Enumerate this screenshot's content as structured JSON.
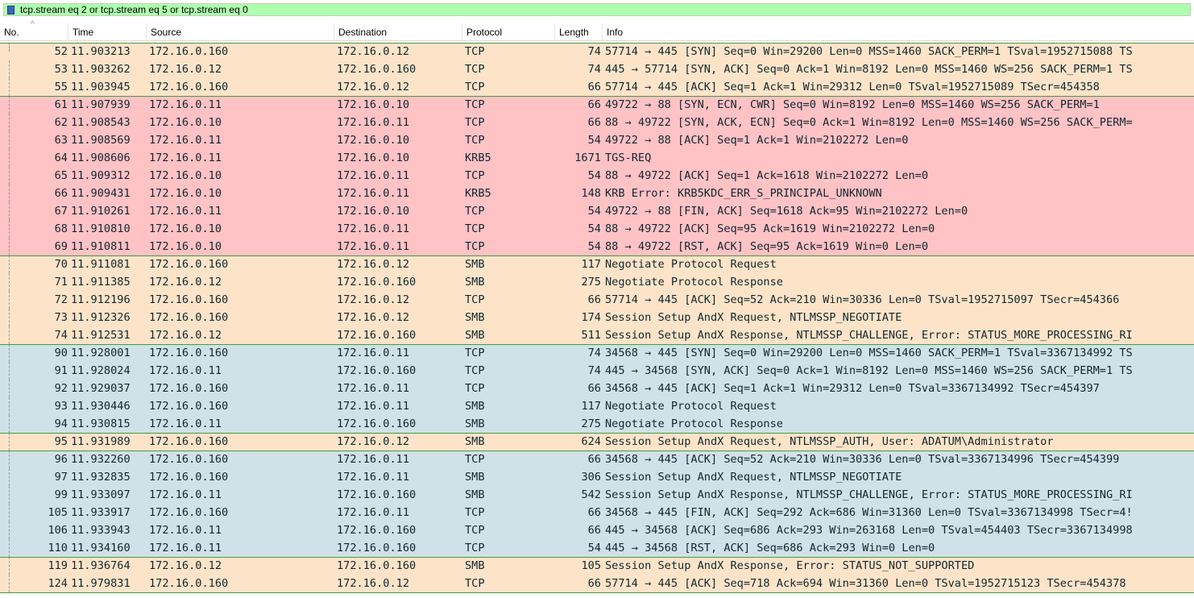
{
  "filter": {
    "text": "tcp.stream eq 2 or tcp.stream eq 5 or tcp.stream eq 0"
  },
  "columns": {
    "no": "No.",
    "time": "Time",
    "source": "Source",
    "destination": "Destination",
    "protocol": "Protocol",
    "length": "Length",
    "info": "Info"
  },
  "colors": {
    "smb": "#fde4c9",
    "kerberos": "#ffc2c5",
    "tcp_blue": "#cfe2e7",
    "separator_green": "#4a9a3c",
    "filter_bg": "#afffaf"
  },
  "packets": [
    {
      "no": "52",
      "time": "11.903213",
      "src": "172.16.0.160",
      "dst": "172.16.0.12",
      "proto": "TCP",
      "len": "74",
      "info": "57714 → 445 [SYN] Seq=0 Win=29200 Len=0 MSS=1460 SACK_PERM=1 TSval=1952715088 TS",
      "color": "smb"
    },
    {
      "no": "53",
      "time": "11.903262",
      "src": "172.16.0.12",
      "dst": "172.16.0.160",
      "proto": "TCP",
      "len": "74",
      "info": "445 → 57714 [SYN, ACK] Seq=0 Ack=1 Win=8192 Len=0 MSS=1460 WS=256 SACK_PERM=1 TS",
      "color": "smb"
    },
    {
      "no": "55",
      "time": "11.903945",
      "src": "172.16.0.160",
      "dst": "172.16.0.12",
      "proto": "TCP",
      "len": "66",
      "info": "57714 → 445 [ACK] Seq=1 Ack=1 Win=29312 Len=0 TSval=1952715089 TSecr=454358",
      "color": "smb"
    },
    {
      "no": "61",
      "time": "11.907939",
      "src": "172.16.0.11",
      "dst": "172.16.0.10",
      "proto": "TCP",
      "len": "66",
      "info": "49722 → 88 [SYN, ECN, CWR] Seq=0 Win=8192 Len=0 MSS=1460 WS=256 SACK_PERM=1",
      "color": "kerberos"
    },
    {
      "no": "62",
      "time": "11.908543",
      "src": "172.16.0.10",
      "dst": "172.16.0.11",
      "proto": "TCP",
      "len": "66",
      "info": "88 → 49722 [SYN, ACK, ECN] Seq=0 Ack=1 Win=8192 Len=0 MSS=1460 WS=256 SACK_PERM=",
      "color": "kerberos"
    },
    {
      "no": "63",
      "time": "11.908569",
      "src": "172.16.0.11",
      "dst": "172.16.0.10",
      "proto": "TCP",
      "len": "54",
      "info": "49722 → 88 [ACK] Seq=1 Ack=1 Win=2102272 Len=0",
      "color": "kerberos"
    },
    {
      "no": "64",
      "time": "11.908606",
      "src": "172.16.0.11",
      "dst": "172.16.0.10",
      "proto": "KRB5",
      "len": "1671",
      "info": "TGS-REQ",
      "color": "kerberos"
    },
    {
      "no": "65",
      "time": "11.909312",
      "src": "172.16.0.10",
      "dst": "172.16.0.11",
      "proto": "TCP",
      "len": "54",
      "info": "88 → 49722 [ACK] Seq=1 Ack=1618 Win=2102272 Len=0",
      "color": "kerberos"
    },
    {
      "no": "66",
      "time": "11.909431",
      "src": "172.16.0.10",
      "dst": "172.16.0.11",
      "proto": "KRB5",
      "len": "148",
      "info": "KRB Error: KRB5KDC_ERR_S_PRINCIPAL_UNKNOWN",
      "color": "kerberos"
    },
    {
      "no": "67",
      "time": "11.910261",
      "src": "172.16.0.11",
      "dst": "172.16.0.10",
      "proto": "TCP",
      "len": "54",
      "info": "49722 → 88 [FIN, ACK] Seq=1618 Ack=95 Win=2102272 Len=0",
      "color": "kerberos"
    },
    {
      "no": "68",
      "time": "11.910810",
      "src": "172.16.0.10",
      "dst": "172.16.0.11",
      "proto": "TCP",
      "len": "54",
      "info": "88 → 49722 [ACK] Seq=95 Ack=1619 Win=2102272 Len=0",
      "color": "kerberos"
    },
    {
      "no": "69",
      "time": "11.910811",
      "src": "172.16.0.10",
      "dst": "172.16.0.11",
      "proto": "TCP",
      "len": "54",
      "info": "88 → 49722 [RST, ACK] Seq=95 Ack=1619 Win=0 Len=0",
      "color": "kerberos"
    },
    {
      "no": "70",
      "time": "11.911081",
      "src": "172.16.0.160",
      "dst": "172.16.0.12",
      "proto": "SMB",
      "len": "117",
      "info": "Negotiate Protocol Request",
      "color": "smb"
    },
    {
      "no": "71",
      "time": "11.911385",
      "src": "172.16.0.12",
      "dst": "172.16.0.160",
      "proto": "SMB",
      "len": "275",
      "info": "Negotiate Protocol Response",
      "color": "smb"
    },
    {
      "no": "72",
      "time": "11.912196",
      "src": "172.16.0.160",
      "dst": "172.16.0.12",
      "proto": "TCP",
      "len": "66",
      "info": "57714 → 445 [ACK] Seq=52 Ack=210 Win=30336 Len=0 TSval=1952715097 TSecr=454366",
      "color": "smb"
    },
    {
      "no": "73",
      "time": "11.912326",
      "src": "172.16.0.160",
      "dst": "172.16.0.12",
      "proto": "SMB",
      "len": "174",
      "info": "Session Setup AndX Request, NTLMSSP_NEGOTIATE",
      "color": "smb"
    },
    {
      "no": "74",
      "time": "11.912531",
      "src": "172.16.0.12",
      "dst": "172.16.0.160",
      "proto": "SMB",
      "len": "511",
      "info": "Session Setup AndX Response, NTLMSSP_CHALLENGE, Error: STATUS_MORE_PROCESSING_RI",
      "color": "smb"
    },
    {
      "no": "90",
      "time": "11.928001",
      "src": "172.16.0.160",
      "dst": "172.16.0.11",
      "proto": "TCP",
      "len": "74",
      "info": "34568 → 445 [SYN] Seq=0 Win=29200 Len=0 MSS=1460 SACK_PERM=1 TSval=3367134992 TS",
      "color": "tcp_blue"
    },
    {
      "no": "91",
      "time": "11.928024",
      "src": "172.16.0.11",
      "dst": "172.16.0.160",
      "proto": "TCP",
      "len": "74",
      "info": "445 → 34568 [SYN, ACK] Seq=0 Ack=1 Win=8192 Len=0 MSS=1460 WS=256 SACK_PERM=1 TS",
      "color": "tcp_blue"
    },
    {
      "no": "92",
      "time": "11.929037",
      "src": "172.16.0.160",
      "dst": "172.16.0.11",
      "proto": "TCP",
      "len": "66",
      "info": "34568 → 445 [ACK] Seq=1 Ack=1 Win=29312 Len=0 TSval=3367134992 TSecr=454397",
      "color": "tcp_blue"
    },
    {
      "no": "93",
      "time": "11.930446",
      "src": "172.16.0.160",
      "dst": "172.16.0.11",
      "proto": "SMB",
      "len": "117",
      "info": "Negotiate Protocol Request",
      "color": "tcp_blue"
    },
    {
      "no": "94",
      "time": "11.930815",
      "src": "172.16.0.11",
      "dst": "172.16.0.160",
      "proto": "SMB",
      "len": "275",
      "info": "Negotiate Protocol Response",
      "color": "tcp_blue"
    },
    {
      "no": "95",
      "time": "11.931989",
      "src": "172.16.0.160",
      "dst": "172.16.0.12",
      "proto": "SMB",
      "len": "624",
      "info": "Session Setup AndX Request, NTLMSSP_AUTH, User: ADATUM\\Administrator",
      "color": "smb"
    },
    {
      "no": "96",
      "time": "11.932260",
      "src": "172.16.0.160",
      "dst": "172.16.0.11",
      "proto": "TCP",
      "len": "66",
      "info": "34568 → 445 [ACK] Seq=52 Ack=210 Win=30336 Len=0 TSval=3367134996 TSecr=454399",
      "color": "tcp_blue"
    },
    {
      "no": "97",
      "time": "11.932835",
      "src": "172.16.0.160",
      "dst": "172.16.0.11",
      "proto": "SMB",
      "len": "306",
      "info": "Session Setup AndX Request, NTLMSSP_NEGOTIATE",
      "color": "tcp_blue"
    },
    {
      "no": "99",
      "time": "11.933097",
      "src": "172.16.0.11",
      "dst": "172.16.0.160",
      "proto": "SMB",
      "len": "542",
      "info": "Session Setup AndX Response, NTLMSSP_CHALLENGE, Error: STATUS_MORE_PROCESSING_RI",
      "color": "tcp_blue"
    },
    {
      "no": "105",
      "time": "11.933917",
      "src": "172.16.0.160",
      "dst": "172.16.0.11",
      "proto": "TCP",
      "len": "66",
      "info": "34568 → 445 [FIN, ACK] Seq=292 Ack=686 Win=31360 Len=0 TSval=3367134998 TSecr=4!",
      "color": "tcp_blue"
    },
    {
      "no": "106",
      "time": "11.933943",
      "src": "172.16.0.11",
      "dst": "172.16.0.160",
      "proto": "TCP",
      "len": "66",
      "info": "445 → 34568 [ACK] Seq=686 Ack=293 Win=263168 Len=0 TSval=454403 TSecr=3367134998",
      "color": "tcp_blue"
    },
    {
      "no": "110",
      "time": "11.934160",
      "src": "172.16.0.11",
      "dst": "172.16.0.160",
      "proto": "TCP",
      "len": "54",
      "info": "445 → 34568 [RST, ACK] Seq=686 Ack=293 Win=0 Len=0",
      "color": "tcp_blue"
    },
    {
      "no": "119",
      "time": "11.936764",
      "src": "172.16.0.12",
      "dst": "172.16.0.160",
      "proto": "SMB",
      "len": "105",
      "info": "Session Setup AndX Response, Error: STATUS_NOT_SUPPORTED",
      "color": "smb"
    },
    {
      "no": "124",
      "time": "11.979831",
      "src": "172.16.0.160",
      "dst": "172.16.0.12",
      "proto": "TCP",
      "len": "66",
      "info": "57714 → 445 [ACK] Seq=718 Ack=694 Win=31360 Len=0 TSval=1952715123 TSecr=454378",
      "color": "smb"
    }
  ]
}
